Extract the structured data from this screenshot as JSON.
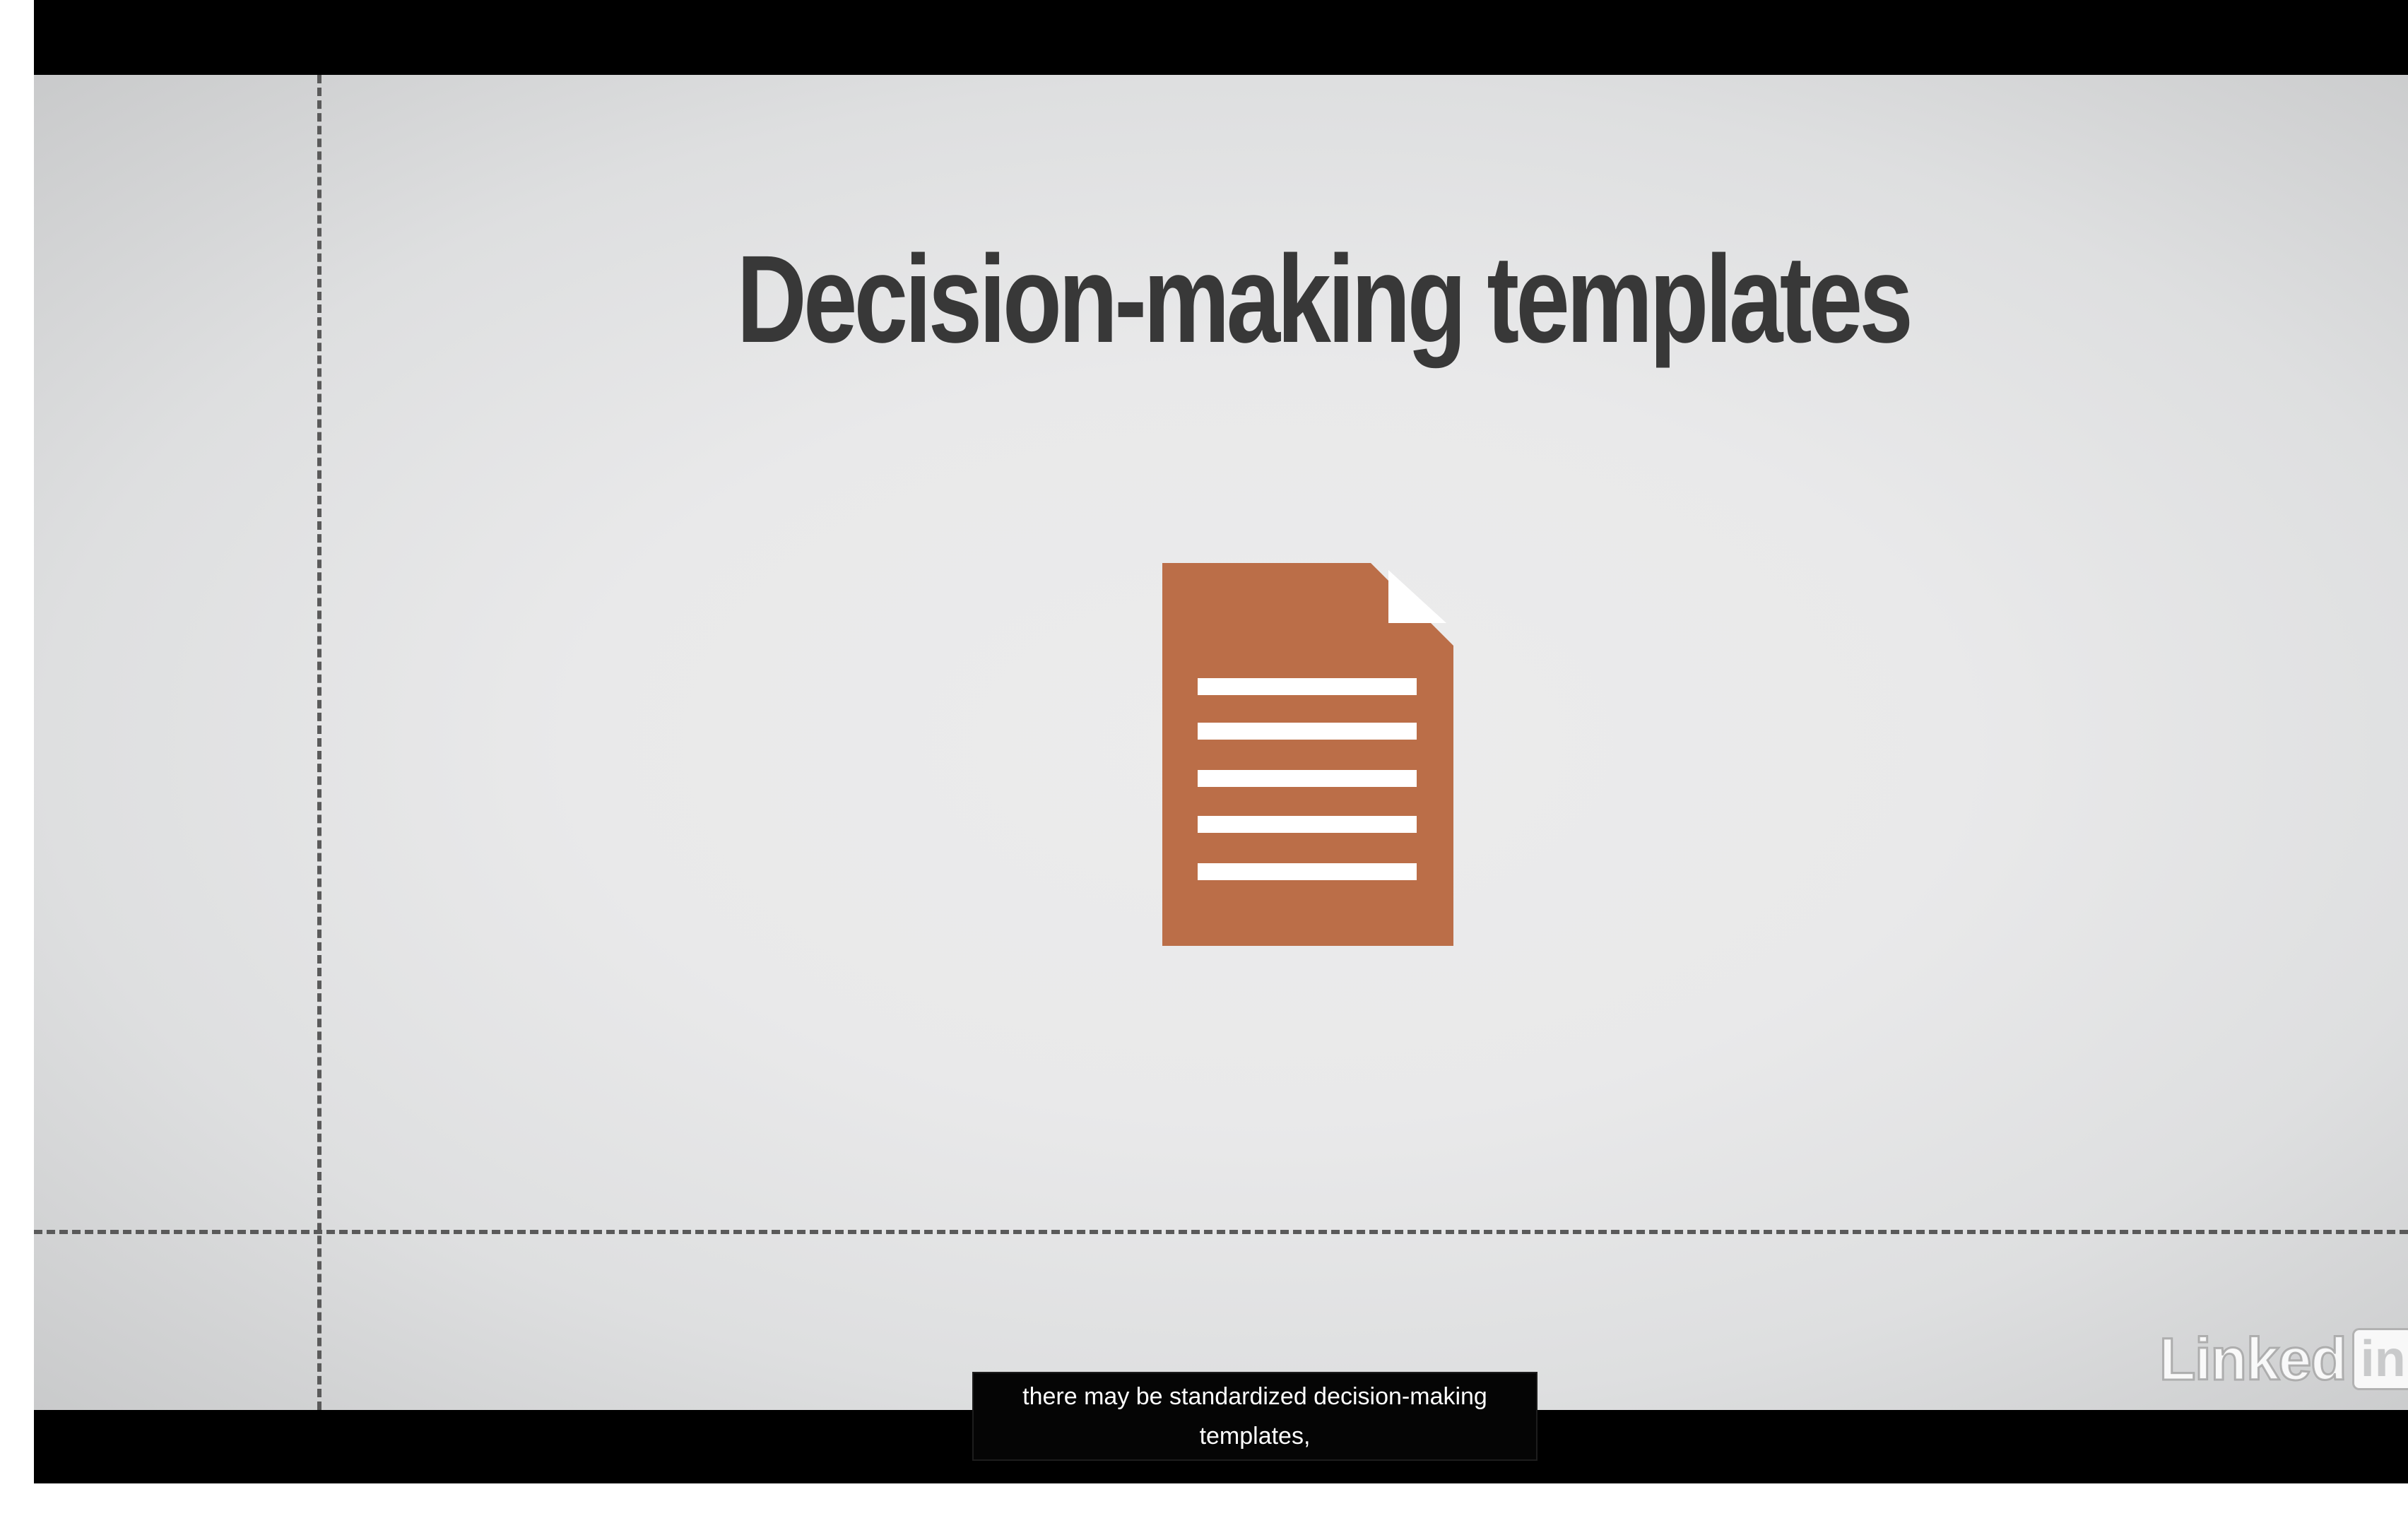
{
  "slide": {
    "title": "Decision-making templates",
    "icon": "document-icon",
    "icon_color": "#bb6e48"
  },
  "watermark": {
    "text": "Linked",
    "box_text": "in"
  },
  "caption": {
    "line1": "there may be standardized decision-making",
    "line2": "templates,"
  },
  "colors": {
    "title": "#383838",
    "stage_background": "#e9e9ea",
    "letterbox": "#000000"
  }
}
